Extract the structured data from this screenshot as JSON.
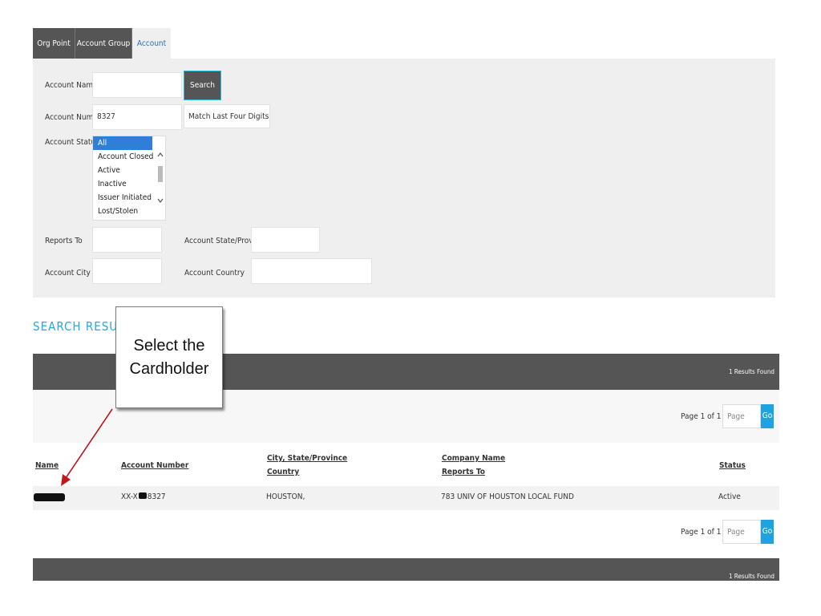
{
  "tabs": [
    {
      "label": "Org Point"
    },
    {
      "label": "Account Group"
    },
    {
      "label": "Account"
    }
  ],
  "form": {
    "account_name_label": "Account Name",
    "account_name_value": "",
    "search_label": "Search",
    "account_number_label": "Account Number",
    "account_number_value": "8327",
    "match_option": "Match Last Four Digits",
    "account_status_label": "Account Status",
    "status_options": [
      "All",
      "Account Closed",
      "Active",
      "Inactive",
      "Issuer Initiated",
      "Lost/Stolen"
    ],
    "status_selected": "All",
    "reports_to_label": "Reports To",
    "state_label": "Account State/Province",
    "city_label": "Account City",
    "country_label": "Account Country"
  },
  "results": {
    "title": "SEARCH RESULTS",
    "count_text": "1 Results Found",
    "page_text": "Page 1 of 1",
    "page_placeholder": "Page",
    "go_label": "Go",
    "headers": {
      "name": "Name",
      "account_number": "Account Number",
      "city_state": "City, State/Province",
      "country": "Country",
      "company_name": "Company Name",
      "reports_to": "Reports To",
      "status": "Status"
    },
    "row": {
      "account_prefix": "XX-X",
      "account_suffix": "8327",
      "city": "HOUSTON,",
      "company": "783 UNIV OF HOUSTON LOCAL FUND",
      "status": "Active"
    }
  },
  "callout": {
    "line1": "Select the",
    "line2": "Cardholder"
  },
  "colors": {
    "accent_blue": "#2aa7d8",
    "dark_bar": "#555555",
    "panel_bg": "#efefef",
    "arrow_red": "#c0181c"
  }
}
